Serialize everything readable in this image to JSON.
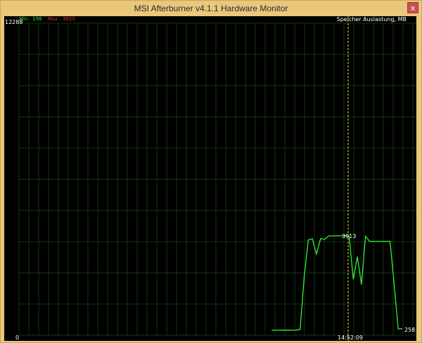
{
  "window": {
    "title": "MSI Afterburner v4.1.1 Hardware Monitor",
    "close_glyph": "x"
  },
  "graph": {
    "ymax_label": "12288",
    "ymin_label": "0",
    "metric_label": "Speicher Auslastung, MB",
    "min_label": "Min : 198",
    "max_label": "Max : 3920",
    "cursor_value": "3913",
    "cursor_time": "14:52:09",
    "current_value": "258"
  },
  "chart_data": {
    "type": "line",
    "ylim": [
      0,
      12288
    ],
    "series": [
      {
        "values": [
          198,
          198,
          205,
          200,
          203,
          198,
          200,
          230,
          2300,
          3750,
          3800,
          3200,
          3800,
          3780,
          3913,
          3913,
          3913,
          3913,
          3920,
          3900,
          2200,
          3100,
          2000,
          3900,
          3700,
          3700,
          3700,
          3700,
          3700,
          3700,
          2000,
          250,
          258
        ]
      }
    ],
    "colors": {
      "line": "#33ee33",
      "grid": "#0b3a0b",
      "cursor": "#e8e838"
    }
  }
}
